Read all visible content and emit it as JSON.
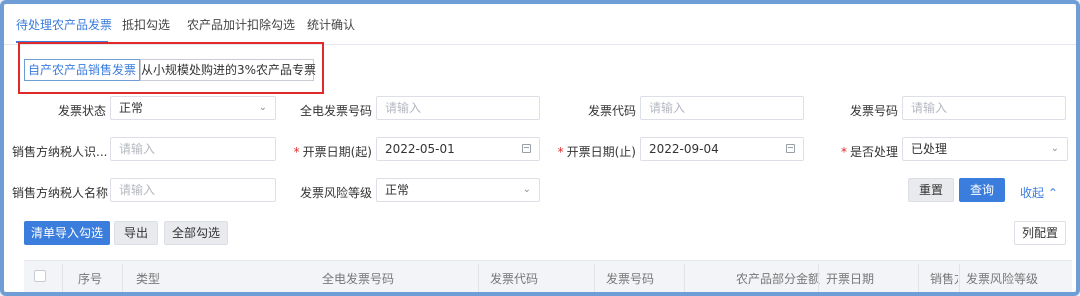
{
  "tabs": [
    {
      "label": "待处理农产品发票"
    },
    {
      "label": "抵扣勾选"
    },
    {
      "label": "农产品加计扣除勾选"
    },
    {
      "label": "统计确认"
    }
  ],
  "invoice_types": [
    {
      "label": "自产农产品销售发票"
    },
    {
      "label": "从小规模处购进的3%农产品专票"
    }
  ],
  "form": {
    "invoice_status": {
      "label": "发票状态",
      "value": "正常"
    },
    "full_digital_number": {
      "label": "全电发票号码",
      "placeholder": "请输入"
    },
    "invoice_code": {
      "label": "发票代码",
      "placeholder": "请输入"
    },
    "invoice_number": {
      "label": "发票号码",
      "placeholder": "请输入"
    },
    "seller_tax_id": {
      "label": "销售方纳税人识...",
      "placeholder": "请输入"
    },
    "issue_date_start": {
      "label": "开票日期(起)",
      "value": "2022-05-01"
    },
    "issue_date_end": {
      "label": "开票日期(止)",
      "value": "2022-09-04"
    },
    "processed": {
      "label": "是否处理",
      "value": "已处理"
    },
    "seller_name": {
      "label": "销售方纳税人名称",
      "placeholder": "请输入"
    },
    "risk_level": {
      "label": "发票风险等级",
      "value": "正常"
    },
    "required_mark": "*"
  },
  "actions": {
    "reset": "重置",
    "query": "查询",
    "collapse": "收起",
    "import_select": "清单导入勾选",
    "export": "导出",
    "select_all": "全部勾选",
    "column_config": "列配置"
  },
  "table": {
    "columns": [
      "序号",
      "类型",
      "全电发票号码",
      "发票代码",
      "发票号码",
      "农产品部分金额",
      "开票日期",
      "销售方",
      "发票风险等级"
    ]
  },
  "colors": {
    "accent": "#3b7ddd",
    "highlight_border": "#e0292b",
    "frame": "#6f9ed6"
  }
}
